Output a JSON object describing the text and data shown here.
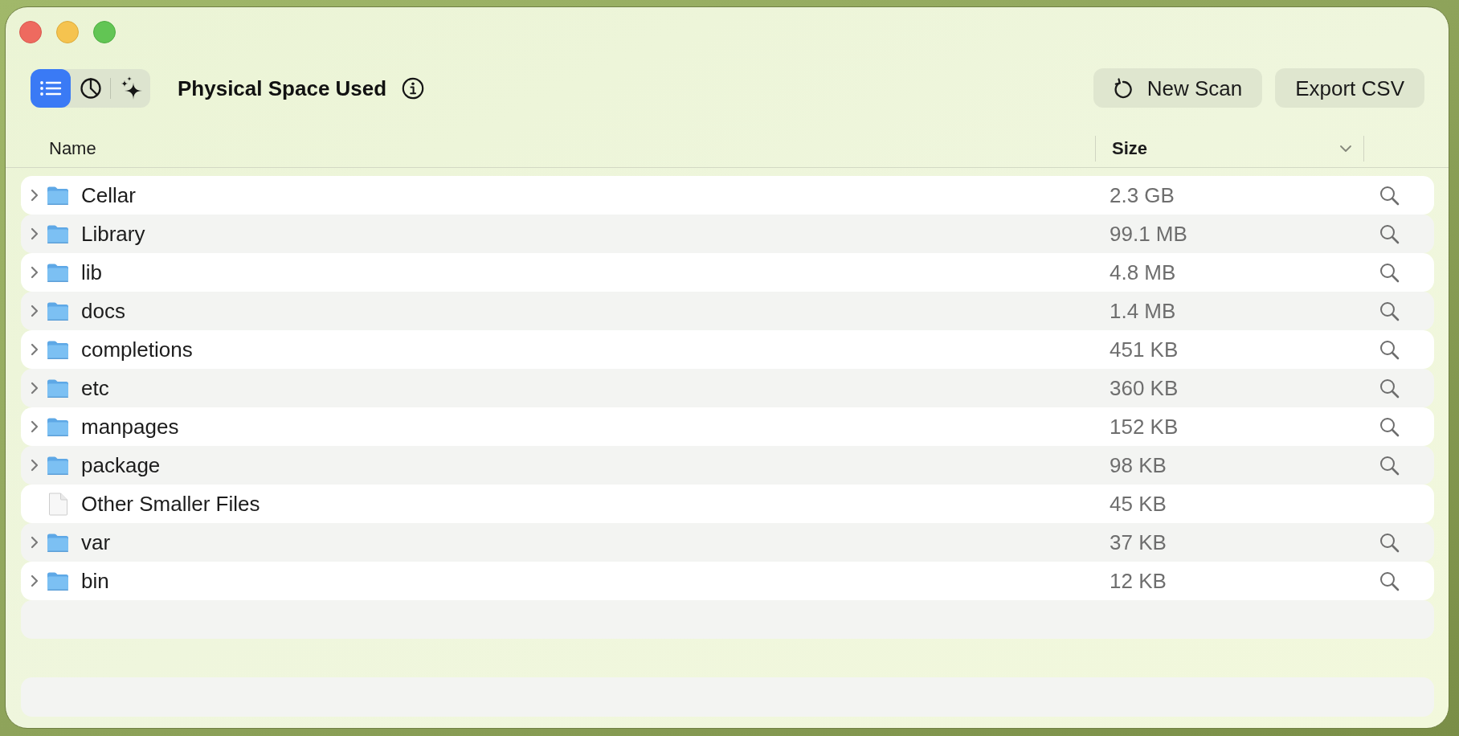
{
  "toolbar": {
    "view_modes": [
      {
        "kind": "list",
        "selected": true
      },
      {
        "kind": "chart",
        "selected": false
      },
      {
        "kind": "sparkle",
        "selected": false
      }
    ],
    "title": "Physical Space Used",
    "buttons": [
      {
        "kind": "refresh",
        "label": "New Scan"
      },
      {
        "kind": "export",
        "label": "Export CSV"
      }
    ]
  },
  "table": {
    "columns": [
      {
        "label": "Name",
        "sorted": false
      },
      {
        "label": "Size",
        "sorted": true
      }
    ],
    "rows": [
      {
        "kind": "folder",
        "name": "Cellar",
        "size": "2.3 GB",
        "expanded": false
      },
      {
        "kind": "folder",
        "name": "Library",
        "size": "99.1 MB",
        "expanded": false
      },
      {
        "kind": "folder",
        "name": "lib",
        "size": "4.8 MB",
        "expanded": false
      },
      {
        "kind": "folder",
        "name": "docs",
        "size": "1.4 MB",
        "expanded": false
      },
      {
        "kind": "folder",
        "name": "completions",
        "size": "451 KB",
        "expanded": false
      },
      {
        "kind": "folder",
        "name": "etc",
        "size": "360 KB",
        "expanded": false
      },
      {
        "kind": "folder",
        "name": "manpages",
        "size": "152 KB",
        "expanded": false
      },
      {
        "kind": "folder",
        "name": "package",
        "size": "98 KB",
        "expanded": false
      },
      {
        "kind": "file",
        "name": "Other Smaller Files",
        "size": "45 KB"
      },
      {
        "kind": "folder",
        "name": "var",
        "size": "37 KB",
        "expanded": false
      },
      {
        "kind": "folder",
        "name": "bin",
        "size": "12 KB",
        "expanded": false
      }
    ]
  }
}
